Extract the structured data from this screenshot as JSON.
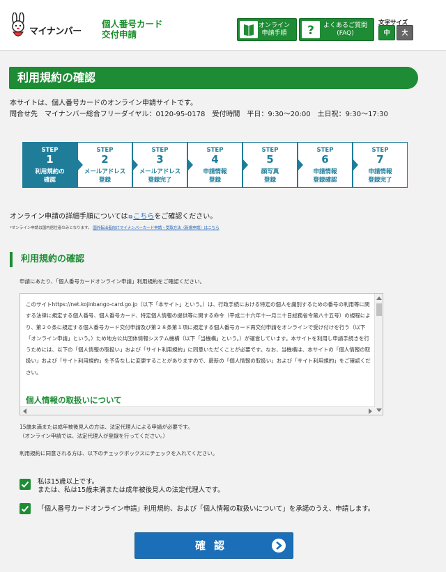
{
  "header": {
    "logo_text": "マイナンバー",
    "site_title_line1": "個人番号カード",
    "site_title_line2": "交付申請",
    "online_button": {
      "line1": "オンライン",
      "line2": "申請手順"
    },
    "faq_button": {
      "line1": "よくあるご質問",
      "line2": "(FAQ)"
    },
    "font_size_label": "文字サイズ",
    "font_size_medium": "中",
    "font_size_large": "大"
  },
  "page": {
    "title": "利用規約の確認",
    "intro_line1": "本サイトは、個人番号カードのオンライン申請サイトです。",
    "intro_line2": "問合せ先　マイナンバー総合フリーダイヤル：0120-95-0178　受付時間　平日：9:30～20:00　土日祝：9:30～17:30"
  },
  "steps": [
    {
      "word": "STEP",
      "num": "1",
      "line1": "利用規約の",
      "line2": "確認",
      "active": true
    },
    {
      "word": "STEP",
      "num": "2",
      "line1": "メールアドレス",
      "line2": "登録",
      "active": false
    },
    {
      "word": "STEP",
      "num": "3",
      "line1": "メールアドレス",
      "line2": "登録完了",
      "active": false
    },
    {
      "word": "STEP",
      "num": "4",
      "line1": "申請情報",
      "line2": "登録",
      "active": false
    },
    {
      "word": "STEP",
      "num": "5",
      "line1": "顔写真",
      "line2": "登録",
      "active": false
    },
    {
      "word": "STEP",
      "num": "6",
      "line1": "申請情報",
      "line2": "登録確認",
      "active": false
    },
    {
      "word": "STEP",
      "num": "7",
      "line1": "申請情報",
      "line2": "登録完了",
      "active": false
    }
  ],
  "guide": {
    "before": "オンライン申請の詳細手順については",
    "link": "こちら",
    "after": "をご確認ください。",
    "small_note_before": "*オンライン申請は国内居住者のみとなります。",
    "small_note_link": "国外転出者向けマイナンバーカード申請・受取方法（新規申請）はこちら"
  },
  "section": {
    "title": "利用規約の確認",
    "lead": "申請にあたり、「個人番号カードオンライン申請」利用規約をご確認ください。",
    "terms_text": "このサイトhttps://net.kojinbango-card.go.jp（以下「本サイト」という。）は、行政手続における特定の個人を識別するための番号の利用等に関する法律に規定する個人番号、個人番号カード、特定個人情報の提供等に関する命令（平成二十六年十一月二十日総務省令第八十五号）の規程により、第２０条に規定する個人番号カード交付申請及び第２８条第１項に規定する個人番号カード再交付申請をオンラインで受け付けを行う（以下「オンライン申請」という。）ため地方公共団体情報システム機構（以下「当機構」という。）が運営しています。本サイトを利用し申請手続きを行うためには、以下の「個人情報の取扱い」および「サイト利用規約」に同意いただくことが必要です。なお、当機構は、本サイトの「個人情報の取扱い」および「サイト利用規約」を予告なしに変更することがありますので、最新の「個人情報の取扱い」および「サイト利用規約」をご確認ください。",
    "terms_heading": "個人情報の取扱いについて",
    "note1_line1": "15歳未満または成年被後見人の方は、法定代理人による申請が必要です。",
    "note1_line2": "（オンライン申請では、法定代理人が登録を行ってください。）",
    "note2": "利用規約に同意される方は、以下のチェックボックスにチェックを入れてください。",
    "check1_line1": "私は15歳以上です。",
    "check1_line2": "または、私は15歳未満または成年被後見人の法定代理人です。",
    "check2": "「個人番号カードオンライン申請」利用規約、および「個人情報の取扱いについて」を承諾のうえ、申請します。",
    "check1_checked": true,
    "check2_checked": true
  },
  "confirm_button": "確認",
  "colors": {
    "brand_green": "#1d8c34",
    "step_blue": "#1f7d9a",
    "button_blue": "#1a6fb8"
  }
}
